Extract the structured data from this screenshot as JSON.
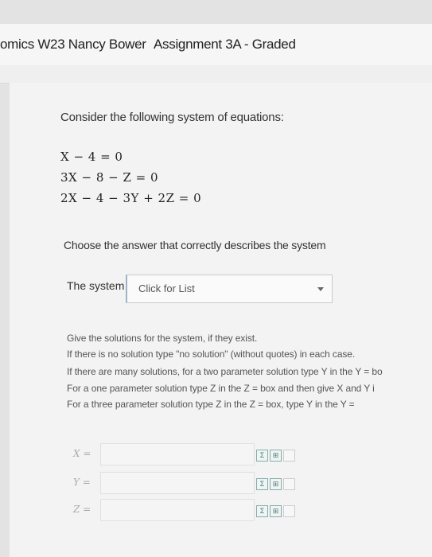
{
  "breadcrumb": {
    "course": "omics W23 Nancy Bower",
    "separator": "/",
    "assignment": "Assignment 3A - Graded"
  },
  "question": {
    "intro": "Consider the following system of equations:",
    "equations": [
      "X − 4 = 0",
      "3X − 8 − Z = 0",
      "2X − 4 − 3Y + 2Z = 0"
    ],
    "choose_prompt": "Choose the answer that correctly describes the system",
    "system_label": "The system",
    "system_select": {
      "placeholder": "Click for List"
    },
    "instructions": [
      "Give the solutions for the system, if they exist.",
      "If there is no solution type \"no solution\" (without quotes) in each case.",
      "If there are many solutions, for a two parameter solution type Y in the Y = bo",
      "For a one parameter solution type Z in the Z =  box and then give X and Y i",
      "For a three parameter solution type Z in the Z =  box, type Y  in the Y ="
    ],
    "answers": [
      {
        "label": "X =",
        "value": ""
      },
      {
        "label": "Y =",
        "value": ""
      },
      {
        "label": "Z =",
        "value": ""
      }
    ]
  },
  "icons": {
    "equation_editor": "equation-editor-icon",
    "preview": "preview-icon",
    "help": "help-icon"
  },
  "colors": {
    "accent": "#9fb4c9"
  }
}
